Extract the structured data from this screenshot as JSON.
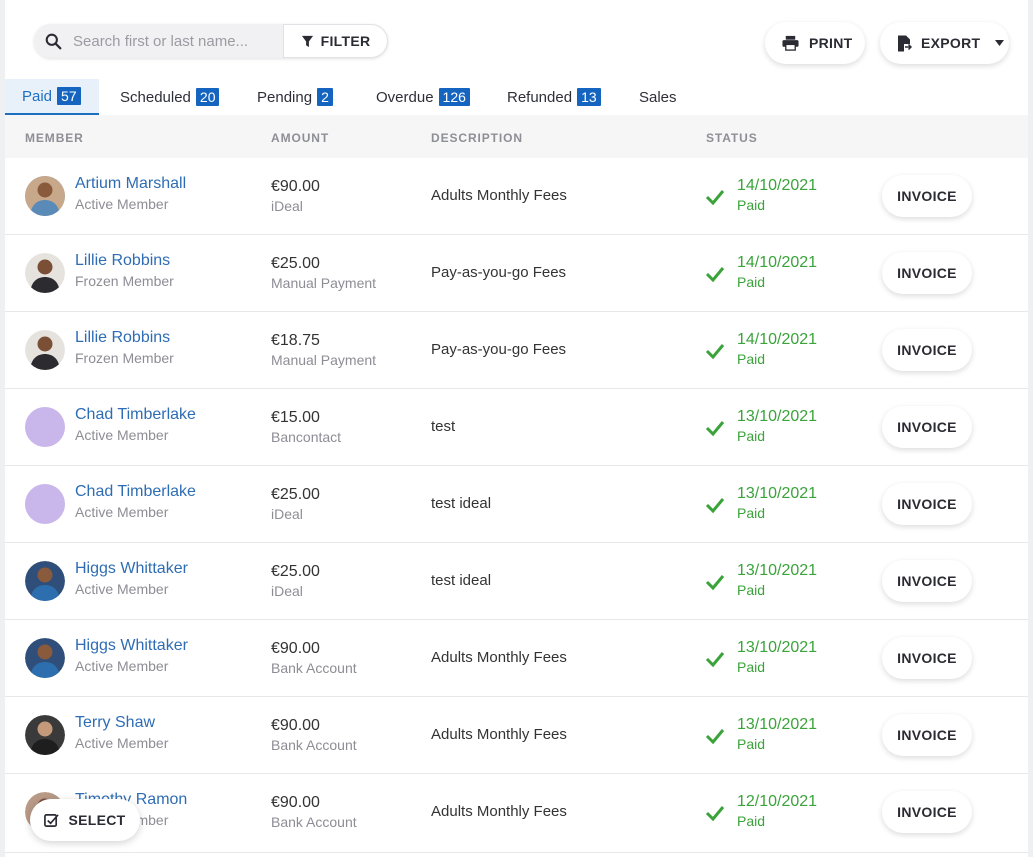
{
  "toolbar": {
    "search_placeholder": "Search first or last name...",
    "filter_label": "FILTER",
    "print_label": "PRINT",
    "export_label": "EXPORT",
    "select_label": "SELECT"
  },
  "tabs": [
    {
      "label": "Paid",
      "count": "57",
      "active": true
    },
    {
      "label": "Scheduled",
      "count": "20"
    },
    {
      "label": "Pending",
      "count": "2"
    },
    {
      "label": "Overdue",
      "count": "126"
    },
    {
      "label": "Refunded",
      "count": "13"
    },
    {
      "label": "Sales",
      "count": ""
    }
  ],
  "table": {
    "headers": {
      "member": "MEMBER",
      "amount": "AMOUNT",
      "description": "DESCRIPTION",
      "status": "STATUS"
    },
    "invoice_label": "INVOICE",
    "rows": [
      {
        "name": "Artium Marshall",
        "member_type": "Active Member",
        "amount": "€90.00",
        "method": "iDeal",
        "description": "Adults Monthly Fees",
        "date": "14/10/2021",
        "status": "Paid",
        "avatar": "photo"
      },
      {
        "name": "Lillie Robbins",
        "member_type": "Frozen Member",
        "amount": "€25.00",
        "method": "Manual Payment",
        "description": "Pay-as-you-go Fees",
        "date": "14/10/2021",
        "status": "Paid",
        "avatar": "photo"
      },
      {
        "name": "Lillie Robbins",
        "member_type": "Frozen Member",
        "amount": "€18.75",
        "method": "Manual Payment",
        "description": "Pay-as-you-go Fees",
        "date": "14/10/2021",
        "status": "Paid",
        "avatar": "photo"
      },
      {
        "name": "Chad Timberlake",
        "member_type": "Active Member",
        "amount": "€15.00",
        "method": "Bancontact",
        "description": "test",
        "date": "13/10/2021",
        "status": "Paid",
        "avatar": "placeholder"
      },
      {
        "name": "Chad Timberlake",
        "member_type": "Active Member",
        "amount": "€25.00",
        "method": "iDeal",
        "description": "test ideal",
        "date": "13/10/2021",
        "status": "Paid",
        "avatar": "placeholder"
      },
      {
        "name": "Higgs Whittaker",
        "member_type": "Active Member",
        "amount": "€25.00",
        "method": "iDeal",
        "description": "test ideal",
        "date": "13/10/2021",
        "status": "Paid",
        "avatar": "photo"
      },
      {
        "name": "Higgs Whittaker",
        "member_type": "Active Member",
        "amount": "€90.00",
        "method": "Bank Account",
        "description": "Adults Monthly Fees",
        "date": "13/10/2021",
        "status": "Paid",
        "avatar": "photo"
      },
      {
        "name": "Terry Shaw",
        "member_type": "Active Member",
        "amount": "€90.00",
        "method": "Bank Account",
        "description": "Adults Monthly Fees",
        "date": "13/10/2021",
        "status": "Paid",
        "avatar": "photo"
      },
      {
        "name": "Timothy Ramon",
        "member_type": "Active Member",
        "amount": "€90.00",
        "method": "Bank Account",
        "description": "Adults Monthly Fees",
        "date": "12/10/2021",
        "status": "Paid",
        "avatar": "photo"
      }
    ]
  },
  "colors": {
    "accent": "#1565c0",
    "link": "#2e6db4",
    "paid": "#3aa33a",
    "placeholder_avatar": "#c9b6ea"
  }
}
